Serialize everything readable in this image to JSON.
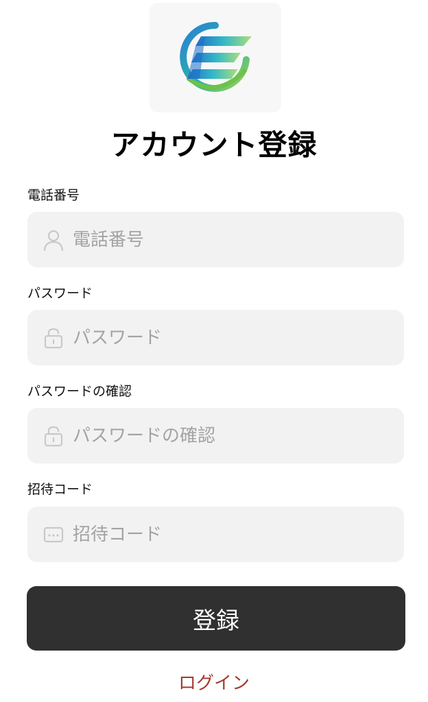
{
  "title": "アカウント登録",
  "fields": [
    {
      "label": "電話番号",
      "placeholder": "電話番号",
      "icon": "user-icon"
    },
    {
      "label": "パスワード",
      "placeholder": "パスワード",
      "icon": "lock-icon"
    },
    {
      "label": "パスワードの確認",
      "placeholder": "パスワードの確認",
      "icon": "lock-icon"
    },
    {
      "label": "招待コード",
      "placeholder": "招待コード",
      "icon": "code-icon"
    }
  ],
  "submit_label": "登録",
  "login_link": "ログイン",
  "colors": {
    "field_bg": "#f2f2f2",
    "button_bg": "#303030",
    "link": "#a33a2e",
    "placeholder": "#a3a3a3"
  }
}
